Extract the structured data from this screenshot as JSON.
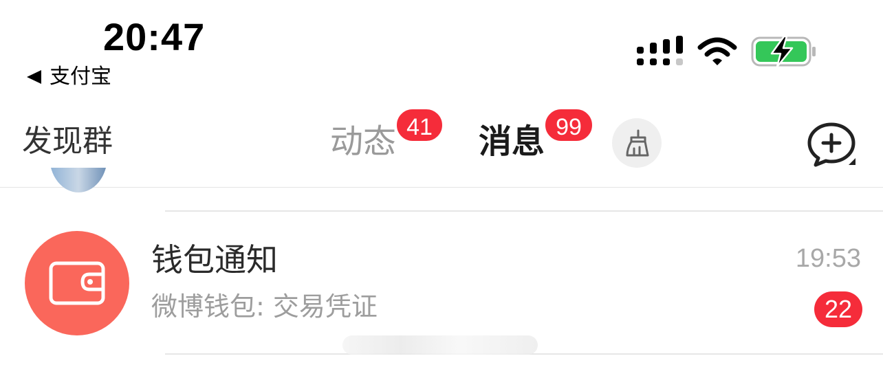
{
  "status_bar": {
    "time": "20:47",
    "back_label": "支付宝",
    "icons": [
      "signal-icon",
      "wifi-icon",
      "battery-charging-icon"
    ],
    "battery_color": "#34c759"
  },
  "nav": {
    "left_label": "发现群",
    "tabs": [
      {
        "label": "动态",
        "badge": "41",
        "active": false
      },
      {
        "label": "消息",
        "badge": "99",
        "active": true
      }
    ],
    "icons": [
      "broom-icon",
      "chat-plus-icon"
    ],
    "accent_color": "#ff9e18",
    "badge_color": "#f52c3a"
  },
  "messages": [
    {
      "title": "钱包通知",
      "subtitle": "微博钱包: 交易凭证",
      "time": "19:53",
      "unread": "22",
      "avatar_icon": "wallet-icon",
      "avatar_color": "#fa675b"
    }
  ]
}
